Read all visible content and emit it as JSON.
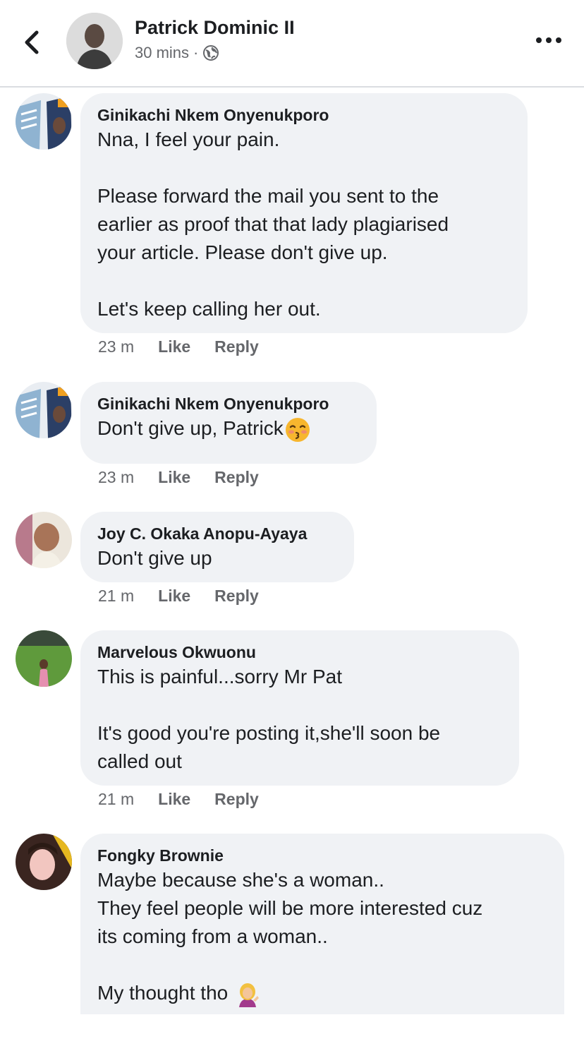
{
  "header": {
    "author": "Patrick Dominic II",
    "time": "30 mins",
    "separator": "·"
  },
  "comments": [
    {
      "author": "Ginikachi Nkem Onyenukporo",
      "text": "Nna, I feel your pain.\n\nPlease forward the mail you sent to the\nearlier as proof that that lady plagiarised\nyour article. Please don't give up.\n\nLet's keep calling her out.",
      "time": "23 m",
      "like": "Like",
      "reply": "Reply"
    },
    {
      "author": "Ginikachi Nkem Onyenukporo",
      "text": "Don't give up, Patrick",
      "emoji": "kissing-face-emoji",
      "time": "23 m",
      "like": "Like",
      "reply": "Reply"
    },
    {
      "author": "Joy C. Okaka Anopu-Ayaya",
      "text": "Don't give up",
      "time": "21 m",
      "like": "Like",
      "reply": "Reply"
    },
    {
      "author": "Marvelous Okwuonu",
      "text": "This is painful...sorry Mr Pat\n\nIt's good you're posting it,she'll soon be\ncalled out",
      "time": "21 m",
      "like": "Like",
      "reply": "Reply"
    },
    {
      "author": "Fongky Brownie",
      "text": "Maybe because she's a woman..\nThey feel people will be more interested cuz\nits coming from a woman..\n\nMy thought tho",
      "emoji": "woman-tipping-hand-emoji"
    }
  ],
  "icons": {
    "back": "chevron-left-icon",
    "privacy": "globe-icon",
    "more": "more-options-icon"
  },
  "colors": {
    "bubble": "#f0f2f5",
    "meta": "#65676b",
    "text": "#1c1e21"
  }
}
